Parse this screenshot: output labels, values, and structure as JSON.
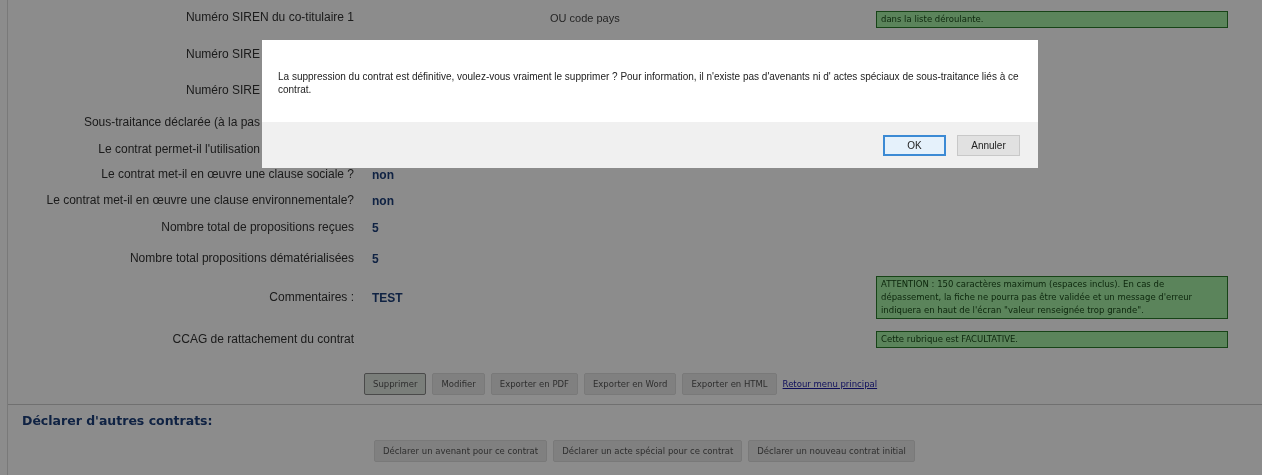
{
  "top_row": {
    "label": "Numéro SIREN du co-titulaire 1",
    "note": "OU code pays",
    "hint": "dans la liste déroulante."
  },
  "rows_behind_dialog": [
    "Numéro SIRE",
    "Numéro SIRE",
    "Sous-traitance déclarée (à la pas",
    "Le contrat permet-il l'utilisation"
  ],
  "form_rows": [
    {
      "label": "Le contrat met-il en œuvre une clause sociale ?",
      "value": "non"
    },
    {
      "label": "Le contrat met-il en œuvre une clause environnementale?",
      "value": "non"
    },
    {
      "label": "Nombre total de propositions reçues",
      "value": "5"
    },
    {
      "label": "Nombre total propositions dématérialisées",
      "value": "5"
    },
    {
      "label": "Commentaires :",
      "value": "TEST",
      "hint": "ATTENTION : 150 caractères maximum (espaces inclus). En cas de dépassement, la fiche ne pourra pas être validée et un message d'erreur indiquera en haut de l'écran \"valeur renseignée trop grande\"."
    },
    {
      "label": "CCAG de rattachement du contrat",
      "hint": "Cette rubrique est FACULTATIVE."
    }
  ],
  "actions": [
    {
      "label": "Supprimer",
      "focused": true
    },
    {
      "label": "Modifier",
      "focused": false
    },
    {
      "label": "Exporter en PDF",
      "focused": false
    },
    {
      "label": "Exporter en Word",
      "focused": false
    },
    {
      "label": "Exporter en HTML",
      "focused": false
    }
  ],
  "back_link": "Retour menu principal",
  "other_contracts": {
    "heading": "Déclarer d'autres contrats:",
    "buttons": [
      "Déclarer un avenant pour ce contrat",
      "Déclarer un acte spécial pour ce contrat",
      "Déclarer un nouveau contrat initial"
    ]
  },
  "dialog": {
    "message": "La suppression du contrat est définitive, voulez-vous vraiment le supprimer ? Pour information, il n'existe pas d'avenants ni d' actes spéciaux de sous-traitance liés à ce contrat.",
    "buttons": [
      {
        "label": "OK",
        "focused": true
      },
      {
        "label": "Annuler",
        "focused": false
      }
    ]
  }
}
